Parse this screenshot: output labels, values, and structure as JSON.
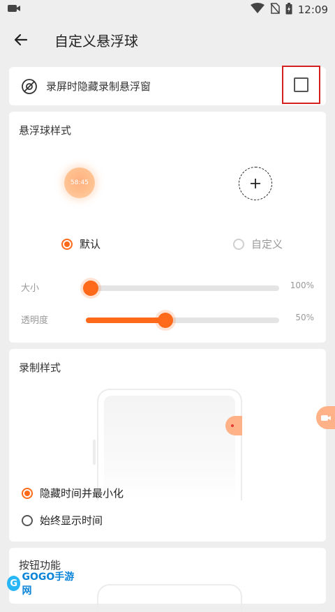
{
  "status_bar": {
    "time": "12:09"
  },
  "header": {
    "title": "自定义悬浮球"
  },
  "hide_floating_window": {
    "label": "录屏时隐藏录制悬浮窗",
    "checked": false
  },
  "floating_ball_style": {
    "title": "悬浮球样式",
    "preview_time": "58:45",
    "options": [
      {
        "label": "默认",
        "selected": true
      },
      {
        "label": "自定义",
        "selected": false
      }
    ],
    "size": {
      "label": "大小",
      "value": "100%",
      "fraction": 0.0
    },
    "opacity": {
      "label": "透明度",
      "value": "50%",
      "fraction": 0.41
    }
  },
  "recording_style": {
    "title": "录制样式",
    "options": [
      {
        "label": "隐藏时间并最小化",
        "selected": true
      },
      {
        "label": "始终显示时间",
        "selected": false
      }
    ]
  },
  "button_function": {
    "title": "按钮功能"
  },
  "watermark": {
    "brand": "GOGO手游网"
  },
  "colors": {
    "accent": "#ff6a1a",
    "highlight_border": "#d42020"
  }
}
